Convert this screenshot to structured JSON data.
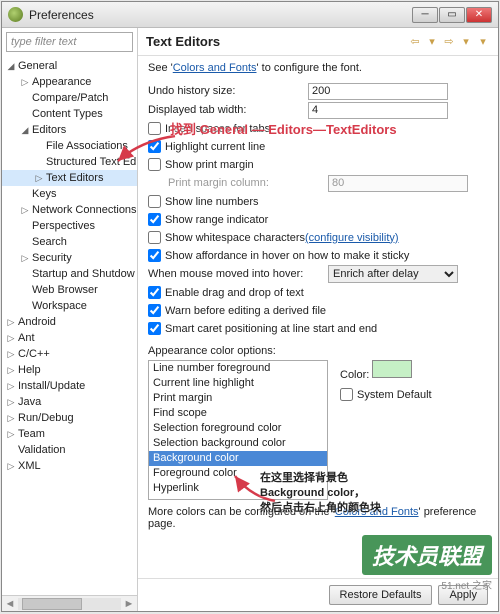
{
  "window": {
    "title": "Preferences"
  },
  "filter_placeholder": "type filter text",
  "tree": [
    {
      "label": "General",
      "depth": 0,
      "exp": true
    },
    {
      "label": "Appearance",
      "depth": 1,
      "leaf": false
    },
    {
      "label": "Compare/Patch",
      "depth": 1,
      "leaf": true
    },
    {
      "label": "Content Types",
      "depth": 1,
      "leaf": true
    },
    {
      "label": "Editors",
      "depth": 1,
      "exp": true
    },
    {
      "label": "File Associations",
      "depth": 2,
      "leaf": true
    },
    {
      "label": "Structured Text Ed",
      "depth": 2,
      "leaf": true
    },
    {
      "label": "Text Editors",
      "depth": 2,
      "leaf": false,
      "sel": true
    },
    {
      "label": "Keys",
      "depth": 1,
      "leaf": true
    },
    {
      "label": "Network Connections",
      "depth": 1,
      "leaf": false
    },
    {
      "label": "Perspectives",
      "depth": 1,
      "leaf": true
    },
    {
      "label": "Search",
      "depth": 1,
      "leaf": true
    },
    {
      "label": "Security",
      "depth": 1,
      "leaf": false
    },
    {
      "label": "Startup and Shutdow",
      "depth": 1,
      "leaf": true
    },
    {
      "label": "Web Browser",
      "depth": 1,
      "leaf": true
    },
    {
      "label": "Workspace",
      "depth": 1,
      "leaf": true
    },
    {
      "label": "Android",
      "depth": 0,
      "leaf": false
    },
    {
      "label": "Ant",
      "depth": 0,
      "leaf": false
    },
    {
      "label": "C/C++",
      "depth": 0,
      "leaf": false
    },
    {
      "label": "Help",
      "depth": 0,
      "leaf": false
    },
    {
      "label": "Install/Update",
      "depth": 0,
      "leaf": false
    },
    {
      "label": "Java",
      "depth": 0,
      "leaf": false
    },
    {
      "label": "Run/Debug",
      "depth": 0,
      "leaf": false
    },
    {
      "label": "Team",
      "depth": 0,
      "leaf": false
    },
    {
      "label": "Validation",
      "depth": 0,
      "leaf": true
    },
    {
      "label": "XML",
      "depth": 0,
      "leaf": false
    }
  ],
  "heading": "Text Editors",
  "intro": {
    "prefix": "See '",
    "link": "Colors and Fonts",
    "suffix": "' to configure the font."
  },
  "fields": {
    "undo_label": "Undo history size:",
    "undo_val": "200",
    "tab_label": "Displayed tab width:",
    "tab_val": "4",
    "insert_spaces": "Insert spaces for tabs",
    "highlight": "Highlight current line",
    "print_margin": "Show print margin",
    "print_col_label": "Print margin column:",
    "print_col_val": "80",
    "line_numbers": "Show line numbers",
    "range": "Show range indicator",
    "whitespace": "Show whitespace characters",
    "whitespace_link": "(configure visibility)",
    "affordance": "Show affordance in hover on how to make it sticky",
    "hover_label": "When mouse moved into hover:",
    "hover_val": "Enrich after delay",
    "dragdrop": "Enable drag and drop of text",
    "derived": "Warn before editing a derived file",
    "caret": "Smart caret positioning at line start and end"
  },
  "color_section": "Appearance color options:",
  "color_items": [
    "Line number foreground",
    "Current line highlight",
    "Print margin",
    "Find scope",
    "Selection foreground color",
    "Selection background color",
    "Background color",
    "Foreground color",
    "Hyperlink"
  ],
  "color_sel_index": 6,
  "color_label": "Color:",
  "sys_default": "System Default",
  "swatch_color": "#c6f0c6",
  "footer_note_prefix": "More colors can be configured on the '",
  "footer_note_link": "Colors and Fonts",
  "footer_note_suffix": "' preference page.",
  "buttons": {
    "restore": "Restore Defaults",
    "apply": "Apply"
  },
  "annotations": {
    "top": "找到 General — Editors—TextEditors",
    "bottom_l1": "在这里选择背景色",
    "bottom_l2": "Background color，",
    "bottom_l3": "然后点击右上角的颜色块"
  },
  "watermark": {
    "main": "技术员联盟",
    "sub": "51.net\n之家"
  }
}
